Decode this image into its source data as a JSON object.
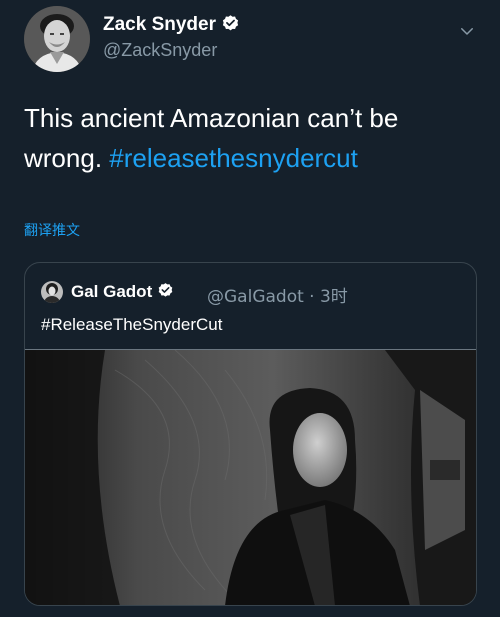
{
  "author": {
    "name": "Zack Snyder",
    "handle": "@ZackSnyder",
    "verified": true
  },
  "menu": {
    "icon": "chevron-down-icon"
  },
  "tweet": {
    "text": "This ancient Amazonian can’t be wrong. ",
    "hashtag": "#releasethesnydercut",
    "translate_label": "翻译推文"
  },
  "quoted": {
    "name": "Gal Gadot",
    "verified": true,
    "handle": "@GalGadot",
    "separator": " · ",
    "time": "3时",
    "text": "#ReleaseTheSnyderCut",
    "photo_description": "Black and white photo of a woman sitting in a vehicle"
  },
  "colors": {
    "background": "#15202b",
    "accent": "#1da1f2",
    "secondary_text": "#8899a6",
    "border": "#38444d"
  }
}
